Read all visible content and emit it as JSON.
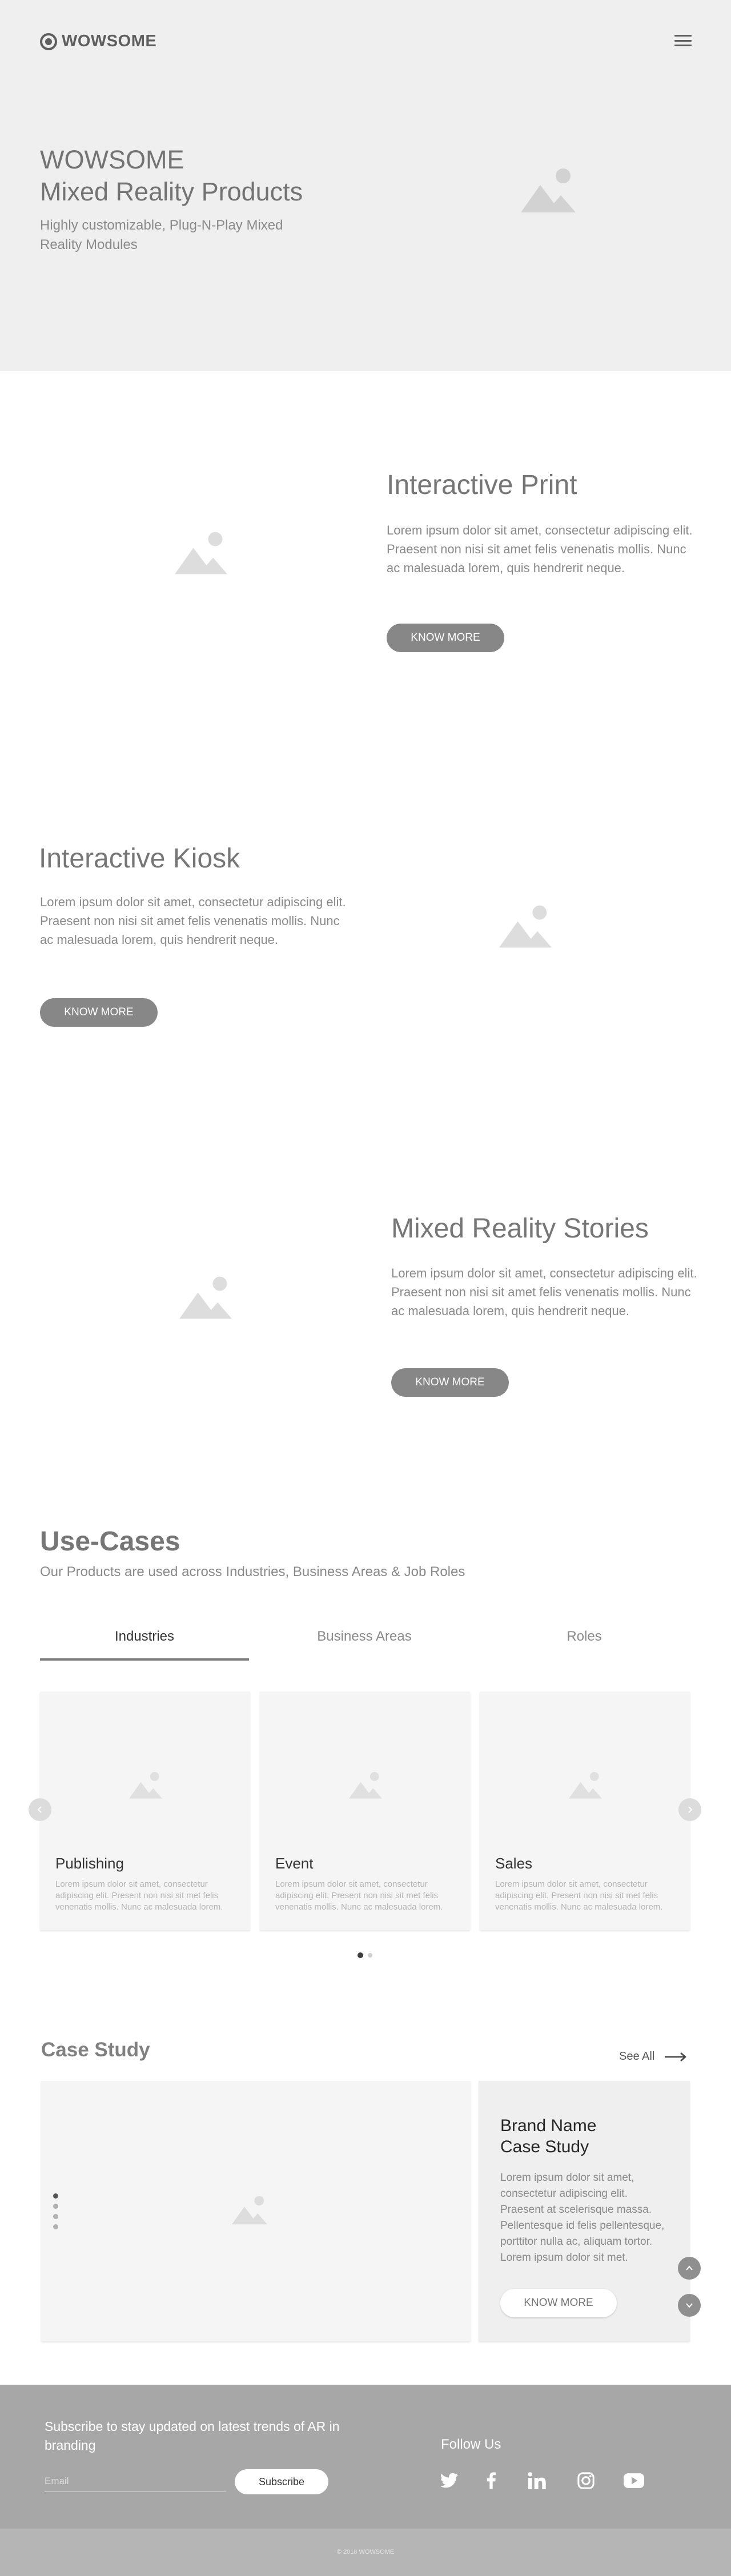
{
  "header": {
    "brand": "WOWSOME",
    "menu_icon": "hamburger-menu-icon"
  },
  "hero": {
    "title_line1": "WOWSOME",
    "title_line2": "Mixed Reality Products",
    "subtitle": "Highly customizable, Plug-N-Play Mixed Reality Modules"
  },
  "features": [
    {
      "title": "Interactive Print",
      "body": "Lorem ipsum dolor sit amet, consectetur adipiscing elit. Praesent non nisi sit amet felis venenatis mollis. Nunc ac malesuada lorem, quis hendrerit neque.",
      "button": "KNOW MORE"
    },
    {
      "title": "Interactive Kiosk",
      "body": "Lorem ipsum dolor sit amet, consectetur adipiscing elit. Praesent non nisi sit amet felis venenatis mollis. Nunc ac malesuada lorem, quis hendrerit neque.",
      "button": "KNOW MORE"
    },
    {
      "title": "Mixed Reality Stories",
      "body": "Lorem ipsum dolor sit amet, consectetur adipiscing elit. Praesent non nisi sit amet felis venenatis mollis. Nunc ac malesuada lorem, quis hendrerit neque.",
      "button": "KNOW MORE"
    }
  ],
  "use_cases": {
    "title": "Use-Cases",
    "subtitle": "Our Products are used across Industries, Business Areas & Job Roles",
    "tabs": [
      {
        "label": "Industries",
        "active": true
      },
      {
        "label": "Business Areas",
        "active": false
      },
      {
        "label": "Roles",
        "active": false
      }
    ],
    "cards": [
      {
        "title": "Publishing",
        "text": "Lorem ipsum dolor sit amet, consectetur adipiscing elit. Present non nisi sit met felis venenatis mollis. Nunc ac malesuada lorem."
      },
      {
        "title": "Event",
        "text": "Lorem ipsum dolor sit amet, consectetur adipiscing elit. Present non nisi sit met felis venenatis mollis. Nunc ac malesuada lorem."
      },
      {
        "title": "Sales",
        "text": "Lorem ipsum dolor sit amet, consectetur adipiscing elit. Present non nisi sit met felis venenatis mollis. Nunc ac malesuada lorem."
      }
    ],
    "carousel_pages": 2,
    "carousel_active": 0
  },
  "case_study": {
    "title": "Case Study",
    "see_all": "See All",
    "brand_line1": "Brand Name",
    "brand_line2": "Case Study",
    "text": "Lorem ipsum dolor sit amet, consectetur adipiscing elit. Praesent at scelerisque massa. Pellentesque id felis pellentesque, porttitor nulla ac, aliquam tortor. Lorem ipsum dolor sit met.",
    "button": "KNOW MORE",
    "slides": 4,
    "active_slide": 0
  },
  "footer": {
    "subscribe_text": "Subscribe to stay updated on latest trends of AR in branding",
    "email_placeholder": "Email",
    "subscribe_button": "Subscribe",
    "follow_label": "Follow Us",
    "social": [
      "twitter-icon",
      "facebook-icon",
      "linkedin-icon",
      "instagram-icon",
      "youtube-icon"
    ],
    "copyright": "© 2018 WOWSOME"
  },
  "colors": {
    "hero_bg": "#efefef",
    "button_dark": "#878787",
    "footer_bg": "#a7a7a7",
    "copyright_bg": "#b5b5b5"
  }
}
